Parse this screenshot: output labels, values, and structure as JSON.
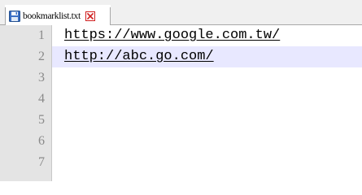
{
  "tab": {
    "file_name": "bookmarklist.txt",
    "icon": "file-save-icon",
    "close_icon": "close-icon"
  },
  "editor": {
    "line_numbers": [
      "1",
      "2",
      "3",
      "4",
      "5",
      "6",
      "7"
    ],
    "lines": [
      "https://www.google.com.tw/",
      "http://abc.go.com/"
    ],
    "current_line": 2
  },
  "colors": {
    "gutter": "#e4e4e4",
    "current_line": "#e8e8ff",
    "tab_icon": "#3b6fc4",
    "close_icon": "#d02020"
  }
}
